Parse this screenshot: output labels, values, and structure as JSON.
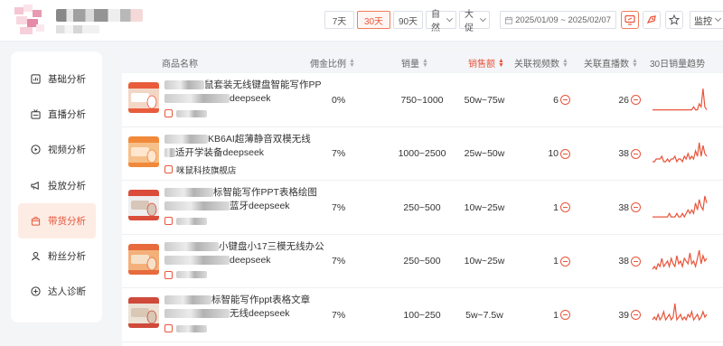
{
  "header": {
    "ranges": [
      "7天",
      "30天",
      "90天"
    ],
    "active_range": "30天",
    "selects": [
      "自然",
      "大促"
    ],
    "date_range": "2025/01/09 ~ 2025/02/07",
    "monitor_label": "监控"
  },
  "sidebar": {
    "items": [
      {
        "label": "基础分析",
        "icon": "chart-icon"
      },
      {
        "label": "直播分析",
        "icon": "live-icon"
      },
      {
        "label": "视频分析",
        "icon": "play-icon"
      },
      {
        "label": "投放分析",
        "icon": "megaphone-icon"
      },
      {
        "label": "带货分析",
        "icon": "bag-icon",
        "active": true
      },
      {
        "label": "粉丝分析",
        "icon": "user-icon"
      },
      {
        "label": "达人诊断",
        "icon": "diagnose-icon"
      }
    ]
  },
  "table": {
    "columns": [
      "商品名称",
      "佣金比例",
      "销量",
      "销售额",
      "关联视频数",
      "关联直播数",
      "30日销量趋势"
    ],
    "sorted_column": "销售额",
    "rows": [
      {
        "name_line1": "鼠套装无线键盘智能写作PP",
        "name_line2": "deepseek",
        "shop": "",
        "commission": "0%",
        "sales": "750~1000",
        "revenue": "50w~75w",
        "videos": "6",
        "lives": "26",
        "trend": [
          1,
          1,
          1,
          1,
          1,
          1,
          1,
          1,
          1,
          1,
          1,
          1,
          1,
          1,
          1,
          1,
          1,
          1,
          1,
          1,
          1,
          1,
          2,
          1,
          1,
          3,
          2,
          8,
          2,
          1
        ]
      },
      {
        "name_line1": "KB6AI超薄静音双模无线",
        "name_line2": "适开学装备deepseek",
        "shop": "咪鼠科技旗舰店",
        "commission": "7%",
        "sales": "1000~2500",
        "revenue": "25w~50w",
        "videos": "10",
        "lives": "38",
        "trend": [
          2,
          2,
          3,
          3,
          3,
          4,
          2,
          2,
          3,
          2,
          3,
          3,
          4,
          2,
          3,
          3,
          2,
          4,
          3,
          5,
          3,
          4,
          3,
          6,
          4,
          9,
          4,
          8,
          5,
          4
        ]
      },
      {
        "name_line1": "标智能写作PPT表格绘图",
        "name_line2": "蓝牙deepseek",
        "shop": "",
        "commission": "7%",
        "sales": "250~500",
        "revenue": "10w~25w",
        "videos": "1",
        "lives": "38",
        "trend": [
          1,
          1,
          1,
          1,
          1,
          1,
          1,
          1,
          1,
          2,
          1,
          1,
          1,
          2,
          1,
          1,
          2,
          1,
          2,
          3,
          2,
          3,
          2,
          5,
          3,
          6,
          4,
          3,
          7,
          5
        ]
      },
      {
        "name_line1": "小键盘小17三模无线办公",
        "name_line2": "deepseek",
        "shop": "",
        "commission": "7%",
        "sales": "250~500",
        "revenue": "10w~25w",
        "videos": "1",
        "lives": "38",
        "trend": [
          2,
          3,
          2,
          4,
          3,
          6,
          3,
          4,
          5,
          3,
          6,
          4,
          3,
          7,
          4,
          5,
          3,
          6,
          5,
          4,
          8,
          4,
          5,
          3,
          6,
          9,
          4,
          7,
          5,
          6
        ]
      },
      {
        "name_line1": "标智能写作ppt表格文章",
        "name_line2": "无线deepseek",
        "shop": "",
        "commission": "7%",
        "sales": "100~250",
        "revenue": "5w~7.5w",
        "videos": "1",
        "lives": "39",
        "trend": [
          3,
          4,
          3,
          5,
          3,
          4,
          6,
          3,
          4,
          5,
          3,
          4,
          9,
          3,
          4,
          5,
          3,
          4,
          3,
          5,
          4,
          6,
          3,
          4,
          5,
          3,
          4,
          6,
          4,
          5
        ]
      }
    ]
  },
  "colors": {
    "accent": "#e8553b",
    "sidebar_active_bg": "#fdece4"
  }
}
